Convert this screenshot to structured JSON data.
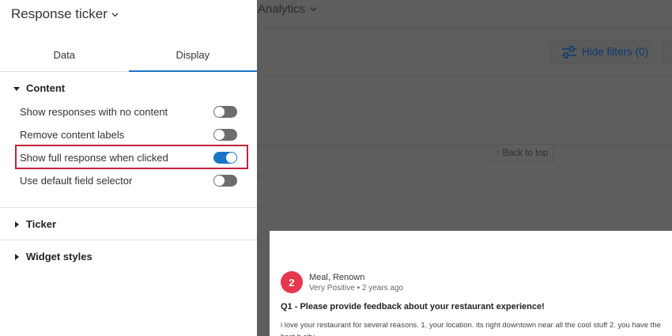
{
  "background": {
    "title": "Analytics",
    "hide_filters_label": "Hide filters (0)",
    "back_to_top_label": "Back to top"
  },
  "response_card": {
    "avatar_number": "2",
    "name": "Meal, Renown",
    "sentiment": "Very Positive",
    "time": "2 years ago",
    "meta": "Very Positive • 2 years ago",
    "question": "Q1 - Please provide feedback about your restaurant experience!",
    "answer": "i love your restaurant for several reasons. 1. your location. its right downtown near all the cool stuff 2. you have the best b city"
  },
  "panel": {
    "title": "Response ticker",
    "tabs": [
      {
        "label": "Data",
        "active": false
      },
      {
        "label": "Display",
        "active": true
      }
    ],
    "sections": {
      "content": {
        "label": "Content",
        "expanded": true,
        "options": [
          {
            "label": "Show responses with no content",
            "on": false
          },
          {
            "label": "Remove content labels",
            "on": false
          },
          {
            "label": "Show full response when clicked",
            "on": true
          },
          {
            "label": "Use default field selector",
            "on": false
          }
        ]
      },
      "ticker": {
        "label": "Ticker",
        "expanded": false
      },
      "widget_styles": {
        "label": "Widget styles",
        "expanded": false
      }
    }
  },
  "colors": {
    "accent": "#1a73c8",
    "highlight_border": "#c0233b",
    "avatar": "#e5374f",
    "toggle_off": "#6d6d6d"
  }
}
